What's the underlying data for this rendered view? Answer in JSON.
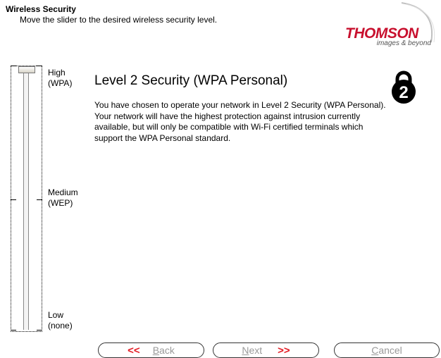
{
  "header": {
    "title": "Wireless Security",
    "subtitle": "Move the slider to the desired wireless security level."
  },
  "brand": {
    "name": "THOMSON",
    "tagline": "images & beyond",
    "color": "#c8102e"
  },
  "slider": {
    "levels": [
      {
        "line1": "High",
        "line2": "(WPA)"
      },
      {
        "line1": "Medium",
        "line2": "(WEP)"
      },
      {
        "line1": "Low",
        "line2": "(none)"
      }
    ],
    "selected": "High"
  },
  "content": {
    "title": "Level 2 Security (WPA Personal)",
    "description": "You have chosen to operate your network in Level 2 Security (WPA Personal). Your network will have the highest protection against intrusion currently available, but will only be compatible with Wi-Fi certified terminals which support the WPA Personal standard.",
    "lock_icon": "lock-level-2-icon"
  },
  "buttons": {
    "back_arrow": "<<",
    "back_first": "B",
    "back_rest": "ack",
    "next_first": "N",
    "next_rest": "ext",
    "next_arrow": ">>",
    "cancel_first": "C",
    "cancel_rest": "ancel"
  }
}
